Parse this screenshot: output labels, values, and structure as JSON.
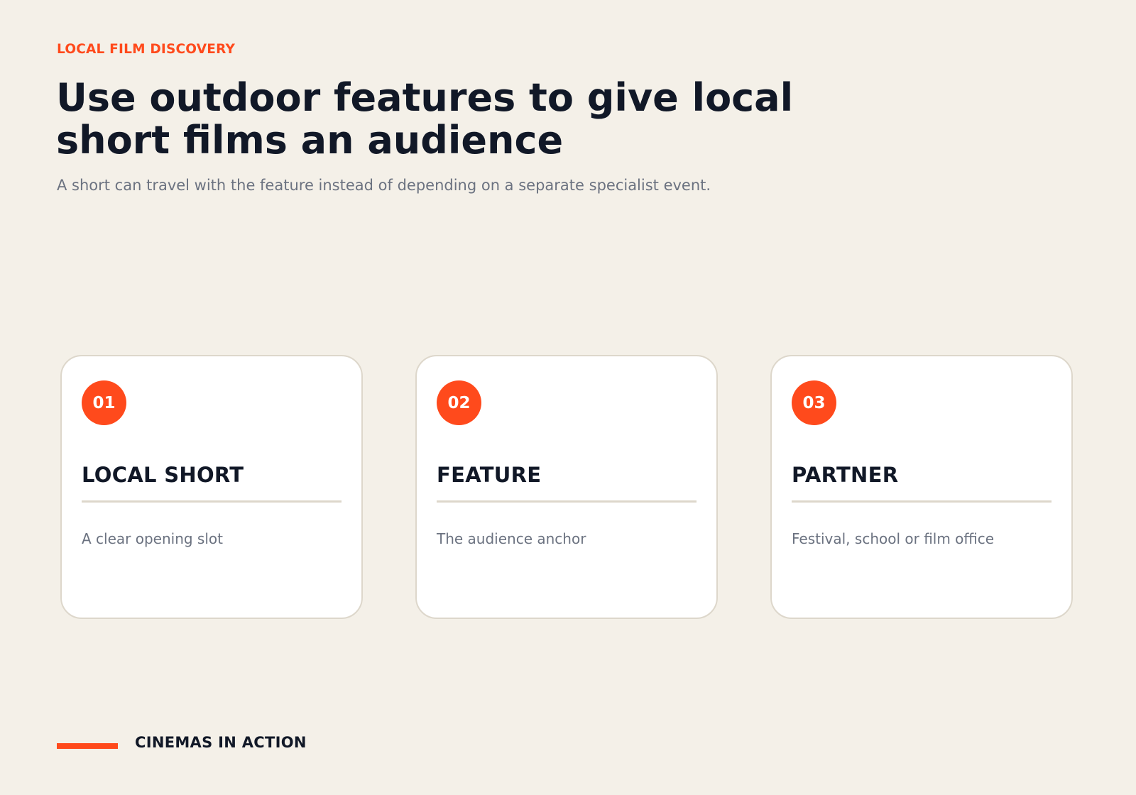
{
  "header": {
    "eyebrow": "LOCAL FILM DISCOVERY",
    "title": "Use outdoor features to give local short films an audience",
    "subtitle": "A short can travel with the feature instead of depending on a separate specialist event."
  },
  "cards": [
    {
      "number": "01",
      "title": "LOCAL SHORT",
      "description": "A clear opening slot"
    },
    {
      "number": "02",
      "title": "FEATURE",
      "description": "The audience anchor"
    },
    {
      "number": "03",
      "title": "PARTNER",
      "description": "Festival, school or film office"
    }
  ],
  "footer": {
    "label": "CINEMAS IN ACTION"
  },
  "colors": {
    "accent": "#ff4a1c",
    "background": "#f4f0e8",
    "heading": "#111827",
    "muted": "#6b7280",
    "card_border": "#ddd7cb"
  }
}
